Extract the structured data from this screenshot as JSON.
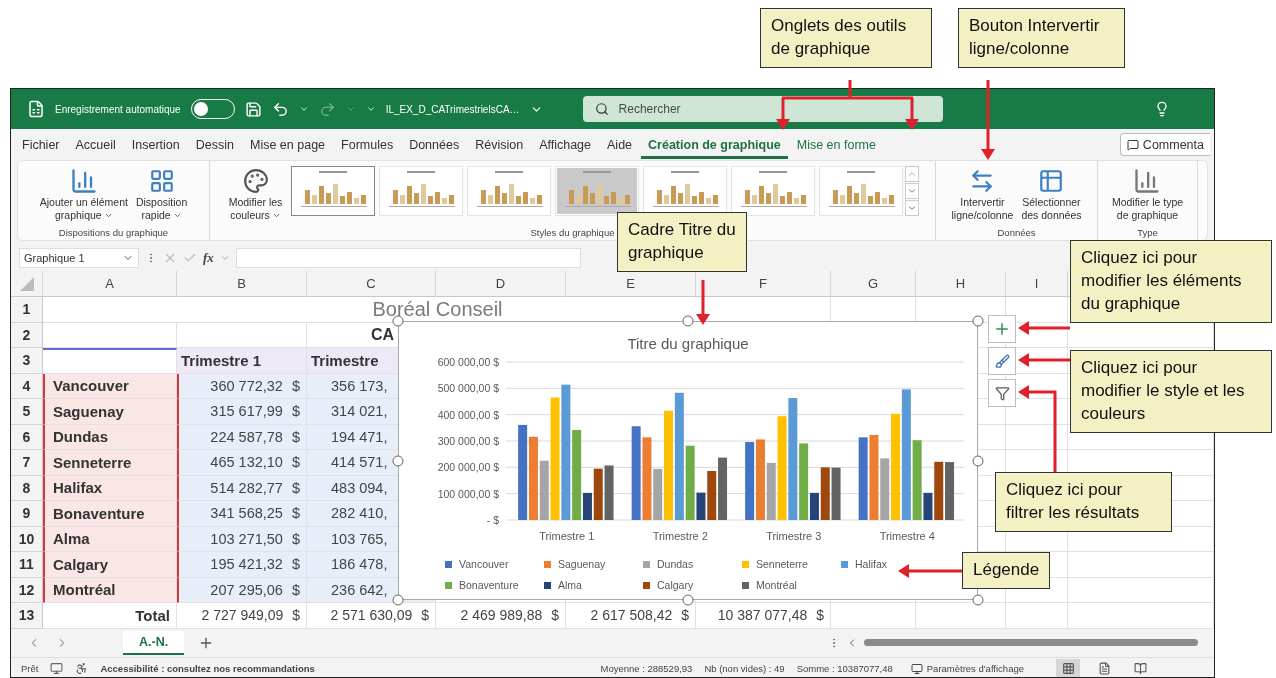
{
  "callouts": [
    {
      "text": "Onglets des outils de graphique"
    },
    {
      "text": "Bouton Intervertir ligne/colonne"
    },
    {
      "text": "Cadre Titre du graphique"
    },
    {
      "text": "Cliquez ici pour modifier les éléments du graphique"
    },
    {
      "text": "Cliquez ici pour modifier le style et les couleurs"
    },
    {
      "text": "Cliquez ici pour filtrer les résultats"
    },
    {
      "text": "Légende"
    }
  ],
  "titlebar": {
    "autosave_label": "Enregistrement automatique",
    "autosave_on": false,
    "redo_disabled": true,
    "file_name": "IL_EX_D_CATrimestrielsCA…",
    "search_placeholder": "Rechercher"
  },
  "ribbon_tabs": [
    {
      "label": "Fichier",
      "selected": false,
      "contextual": false
    },
    {
      "label": "Accueil",
      "selected": false,
      "contextual": false
    },
    {
      "label": "Insertion",
      "selected": false,
      "contextual": false
    },
    {
      "label": "Dessin",
      "selected": false,
      "contextual": false
    },
    {
      "label": "Mise en page",
      "selected": false,
      "contextual": false
    },
    {
      "label": "Formules",
      "selected": false,
      "contextual": false
    },
    {
      "label": "Données",
      "selected": false,
      "contextual": false
    },
    {
      "label": "Révision",
      "selected": false,
      "contextual": false
    },
    {
      "label": "Affichage",
      "selected": false,
      "contextual": false
    },
    {
      "label": "Aide",
      "selected": false,
      "contextual": false
    },
    {
      "label": "Création de graphique",
      "selected": true,
      "contextual": true
    },
    {
      "label": "Mise en forme",
      "selected": false,
      "contextual": true
    }
  ],
  "comment_button": "Commenta",
  "ribbon_groups": [
    {
      "label": "Dispositions du graphique",
      "buttons": [
        {
          "kind": "add-element",
          "lines": [
            "Ajouter un élément",
            "graphique"
          ],
          "dropdown": true
        },
        {
          "kind": "quick-layout",
          "lines": [
            "Disposition",
            "rapide"
          ],
          "dropdown": true
        }
      ]
    },
    {
      "label": "Styles du graphique",
      "buttons": [
        {
          "kind": "colors",
          "lines": [
            "Modifier les",
            "couleurs"
          ],
          "dropdown": true
        }
      ],
      "styles": [
        {
          "selected": true
        },
        {
          "selected": false
        },
        {
          "selected": false
        },
        {
          "selected": false
        },
        {
          "selected": false
        },
        {
          "selected": false
        },
        {
          "selected": false
        }
      ]
    },
    {
      "label": "Données",
      "buttons": [
        {
          "kind": "switch",
          "lines": [
            "Intervertir",
            "ligne/colonne"
          ],
          "dropdown": false
        },
        {
          "kind": "select-data",
          "lines": [
            "Sélectionner",
            "des données"
          ],
          "dropdown": false
        }
      ]
    },
    {
      "label": "Type",
      "buttons": [
        {
          "kind": "chart-type",
          "lines": [
            "Modifier le type",
            "de graphique"
          ],
          "dropdown": false
        }
      ]
    }
  ],
  "formula_bar": {
    "name_box": "Graphique 1",
    "function_label": "fx"
  },
  "sheet": {
    "columns": [
      "A",
      "B",
      "C",
      "D",
      "E",
      "F",
      "G",
      "H",
      "I"
    ],
    "rows": [
      {
        "number": "1",
        "kind": "title",
        "text": "Boréal Conseil"
      },
      {
        "number": "2",
        "kind": "subtitle",
        "text": "CA"
      },
      {
        "number": "3",
        "kind": "header",
        "cells": [
          "Trimestre 1",
          "Trimestre"
        ]
      },
      {
        "number": "4",
        "kind": "data",
        "city": "Vancouver",
        "amount": "360 772,32",
        "currency": "$",
        "next": "356 173,"
      },
      {
        "number": "5",
        "kind": "data",
        "city": "Saguenay",
        "amount": "315 617,99",
        "currency": "$",
        "next": "314 021,"
      },
      {
        "number": "6",
        "kind": "data",
        "city": "Dundas",
        "amount": "224 587,78",
        "currency": "$",
        "next": "194 471,"
      },
      {
        "number": "7",
        "kind": "data",
        "city": "Senneterre",
        "amount": "465 132,10",
        "currency": "$",
        "next": "414 571,"
      },
      {
        "number": "8",
        "kind": "data",
        "city": "Halifax",
        "amount": "514 282,77",
        "currency": "$",
        "next": "483 094,"
      },
      {
        "number": "9",
        "kind": "data",
        "city": "Bonaventure",
        "amount": "341 568,25",
        "currency": "$",
        "next": "282 410,"
      },
      {
        "number": "10",
        "kind": "data",
        "city": "Alma",
        "amount": "103 271,50",
        "currency": "$",
        "next": "103 765,"
      },
      {
        "number": "11",
        "kind": "data",
        "city": "Calgary",
        "amount": "195 421,32",
        "currency": "$",
        "next": "186 478,"
      },
      {
        "number": "12",
        "kind": "data",
        "city": "Montréal",
        "amount": "207 295,06",
        "currency": "$",
        "next": "236 642,"
      },
      {
        "number": "13",
        "kind": "total",
        "label": "Total",
        "amounts": [
          {
            "amount": "2 727 949,09",
            "currency": "$"
          },
          {
            "amount": "2 571 630,09",
            "currency": "$"
          },
          {
            "amount": "2 469 989,88",
            "currency": "$"
          },
          {
            "amount": "2 617 508,42",
            "currency": "$"
          },
          {
            "amount": "10 387 077,48",
            "currency": "$"
          }
        ]
      }
    ]
  },
  "chart": {
    "chart_data": {
      "type": "bar",
      "title": "Titre du graphique",
      "grid": true,
      "legend": true,
      "categories": [
        "Trimestre 1",
        "Trimestre 2",
        "Trimestre 3",
        "Trimestre 4"
      ],
      "series": [
        {
          "name": "Vancouver",
          "color": "#4472c4",
          "values": [
            361000,
            356000,
            296000,
            314000
          ]
        },
        {
          "name": "Saguenay",
          "color": "#ed7d31",
          "values": [
            316000,
            314000,
            306000,
            323000
          ]
        },
        {
          "name": "Dundas",
          "color": "#a5a5a5",
          "values": [
            225000,
            194000,
            217000,
            234000
          ]
        },
        {
          "name": "Senneterre",
          "color": "#ffc000",
          "values": [
            465000,
            415000,
            394000,
            403000
          ]
        },
        {
          "name": "Halifax",
          "color": "#5b9bd5",
          "values": [
            514000,
            483000,
            463000,
            496000
          ]
        },
        {
          "name": "Bonaventure",
          "color": "#70ad47",
          "values": [
            342000,
            282000,
            291000,
            303000
          ]
        },
        {
          "name": "Alma",
          "color": "#264478",
          "values": [
            103000,
            104000,
            103000,
            103000
          ]
        },
        {
          "name": "Calgary",
          "color": "#9e480e",
          "values": [
            195000,
            186000,
            200000,
            221000
          ]
        },
        {
          "name": "Montréal",
          "color": "#636363",
          "values": [
            207000,
            237000,
            199000,
            220000
          ]
        }
      ],
      "ylim": [
        0,
        600000
      ],
      "yticks": [
        {
          "value": 0,
          "label": "- $"
        },
        {
          "value": 100000,
          "label": "100 000,00 $"
        },
        {
          "value": 200000,
          "label": "200 000,00 $"
        },
        {
          "value": 300000,
          "label": "300 000,00 $"
        },
        {
          "value": 400000,
          "label": "400 000,00 $"
        },
        {
          "value": 500000,
          "label": "500 000,00 $"
        },
        {
          "value": 600000,
          "label": "600 000,00 $"
        }
      ]
    }
  },
  "sheet_tabs": [
    {
      "label": "A.-N.",
      "selected": true
    }
  ],
  "status_bar": {
    "ready": "Prêt",
    "accessibility": "Accessibilité : consultez nos recommandations",
    "average": "Moyenne : 288529,93",
    "count": "Nb (non vides) : 49",
    "sum": "Somme : 10387077,48",
    "display_settings": "Paramètres d'affichage",
    "views": [
      {
        "kind": "normal",
        "selected": true
      },
      {
        "kind": "page-layout",
        "selected": false
      },
      {
        "kind": "page-break",
        "selected": false
      }
    ]
  }
}
